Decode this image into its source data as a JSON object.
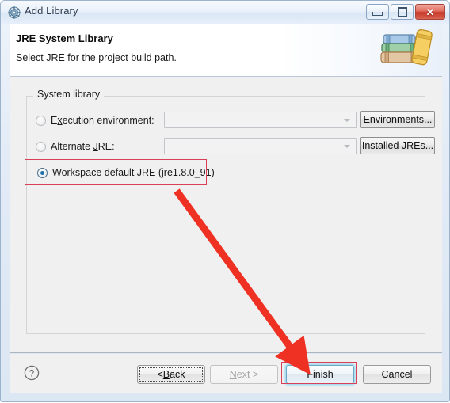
{
  "window": {
    "title": "Add Library",
    "icon": "library-gear-icon",
    "controls": {
      "minimize": "Minimize",
      "maximize": "Maximize",
      "close": "Close"
    }
  },
  "header": {
    "title": "JRE System Library",
    "subtitle": "Select JRE for the project build path.",
    "icon": "books-stack-icon"
  },
  "group": {
    "legend": "System library",
    "options": [
      {
        "id": "execution-environment",
        "label_pre": "E",
        "label_mnemonic": "x",
        "label_post": "ecution environment:",
        "full_label": "Execution environment:",
        "selected": false,
        "combo_value": "",
        "button": {
          "pre": "Envir",
          "mnemonic": "o",
          "post": "nments...",
          "full": "Environments..."
        }
      },
      {
        "id": "alternate-jre",
        "label_pre": "Alternate ",
        "label_mnemonic": "J",
        "label_post": "RE:",
        "full_label": "Alternate JRE:",
        "selected": false,
        "combo_value": "",
        "button": {
          "pre": "",
          "mnemonic": "I",
          "post": "nstalled JREs...",
          "full": "Installed JREs..."
        }
      },
      {
        "id": "workspace-default-jre",
        "label_pre": "Workspace ",
        "label_mnemonic": "d",
        "label_post": "efault JRE (jre1.8.0_91)",
        "full_label": "Workspace default JRE (jre1.8.0_91)",
        "selected": true,
        "highlighted": true
      }
    ]
  },
  "footer": {
    "help_icon": "help-question-icon",
    "buttons": [
      {
        "id": "back",
        "pre": "< ",
        "mnemonic": "B",
        "post": "ack",
        "full": "< Back",
        "state": "focused"
      },
      {
        "id": "next",
        "pre": "",
        "mnemonic": "N",
        "post": "ext >",
        "full": "Next >",
        "state": "disabled"
      },
      {
        "id": "finish",
        "pre": "Finish",
        "mnemonic": "",
        "post": "",
        "full": "Finish",
        "state": "default"
      },
      {
        "id": "cancel",
        "pre": "Cancel",
        "mnemonic": "",
        "post": "",
        "full": "Cancel",
        "state": "normal"
      }
    ]
  },
  "annotations": {
    "highlight_color": "#d94057",
    "arrow_color": "#ef3124",
    "arrow_from": "workspace-default-jre",
    "arrow_to": "finish"
  }
}
